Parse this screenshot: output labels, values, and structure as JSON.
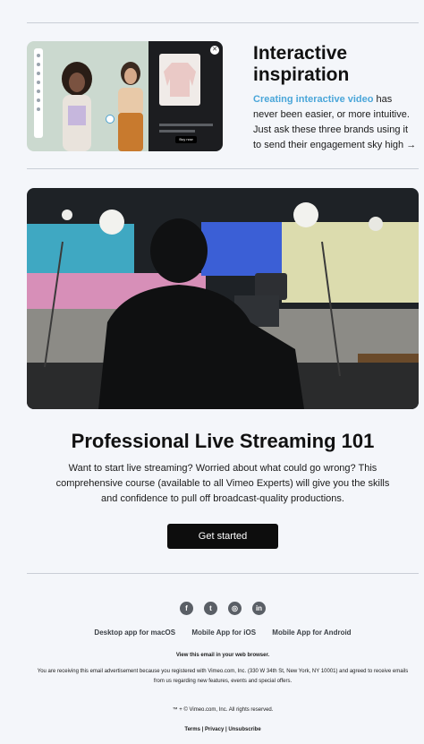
{
  "promo": {
    "title": "Interactive inspiration",
    "link_text": "Creating interactive video",
    "body_rest": " has never been easier, or more intuitive. Just ask these three brands using it to send their engagement sky high →",
    "image_button": "Buy now"
  },
  "hero": {
    "title": "Professional Live Streaming 101",
    "description": "Want to start live streaming? Worried about what could go wrong? This comprehensive course (available to all Vimeo Experts) will give you the skills and confidence to pull off broadcast-quality productions.",
    "cta_label": "Get started"
  },
  "footer": {
    "socials": [
      {
        "name": "facebook-icon",
        "glyph": "f"
      },
      {
        "name": "twitter-icon",
        "glyph": "t"
      },
      {
        "name": "instagram-icon",
        "glyph": "◎"
      },
      {
        "name": "linkedin-icon",
        "glyph": "in"
      }
    ],
    "apps": {
      "mac": "Desktop app for macOS",
      "ios": "Mobile App for iOS",
      "android": "Mobile App for Android"
    },
    "web_view": "View this email in your web browser.",
    "disclaimer": "You are receiving this email advertisement because you registered with Vimeo.com, Inc. (330 W 34th St, New York, NY 10001) and agreed to receive emails from us regarding new features, events and special offers.",
    "copyright": "™ + © Vimeo.com, Inc. All rights reserved.",
    "terms": "Terms",
    "privacy": "Privacy",
    "unsubscribe": "Unsubscribe",
    "sep": " | "
  },
  "colors": {
    "page_bg": "#f4f6fa",
    "link": "#4aa6d9",
    "button_bg": "#0d0d0d",
    "social_icon_bg": "#5a5f66"
  }
}
